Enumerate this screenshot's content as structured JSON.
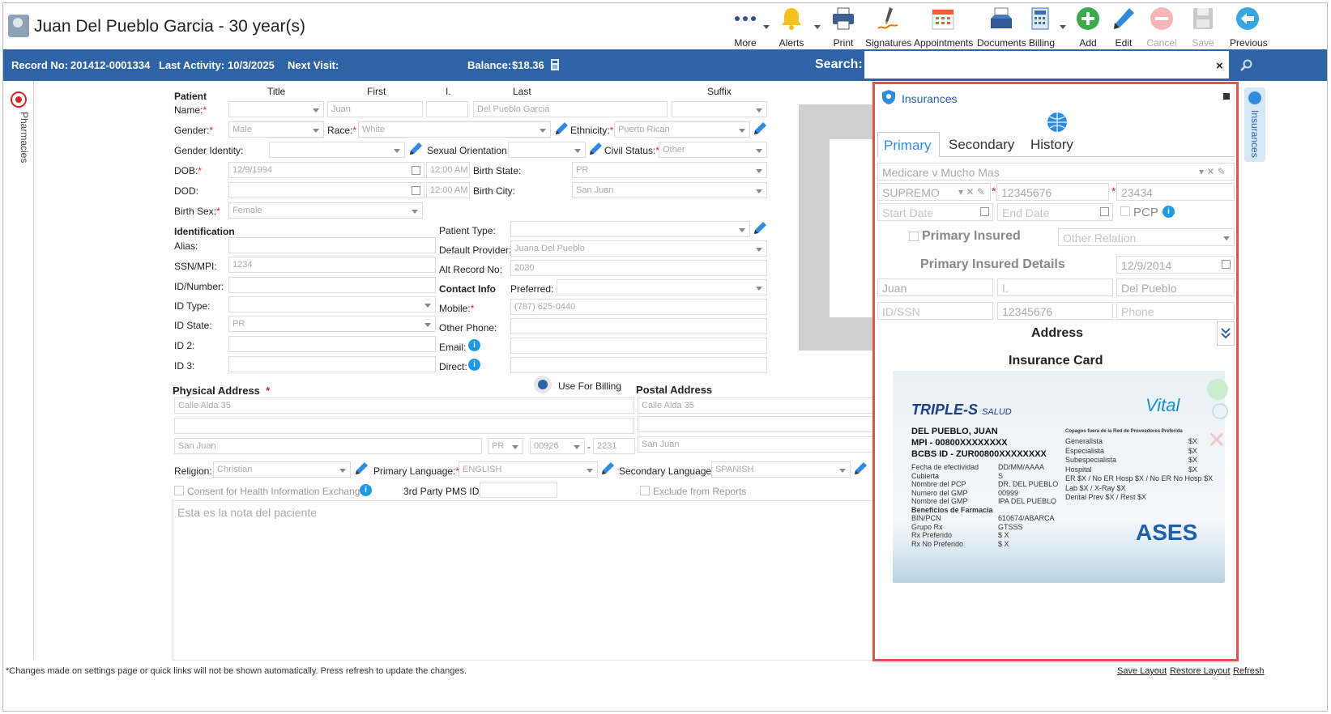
{
  "header": {
    "title": "Juan Del Pueblo Garcia - 30 year(s)",
    "toolbar": {
      "more": "More",
      "alerts": "Alerts",
      "print": "Print",
      "signatures": "Signatures",
      "appointments": "Appointments",
      "documents": "Documents",
      "billing": "Billing",
      "add": "Add",
      "edit": "Edit",
      "cancel": "Cancel",
      "save": "Save",
      "previous": "Previous"
    }
  },
  "infobar": {
    "record_label": "Record No:",
    "record_value": "201412-0001334",
    "activity_label": "Last Activity:",
    "activity_value": "10/3/2025",
    "next_visit_label": "Next Visit:",
    "balance_label": "Balance:",
    "balance_value": "$18.36",
    "search_label": "Search:",
    "search_clear": "×"
  },
  "left_sidebar": {
    "pharmacies": "Pharmacies"
  },
  "right_sidebar": {
    "insurances": "Insurances"
  },
  "patient": {
    "section": "Patient",
    "col_title": "Title",
    "col_first": "First",
    "col_initial": "I.",
    "col_last": "Last",
    "col_suffix": "Suffix",
    "name_label": "Name:",
    "first": "Juan",
    "last": "Del Pueblo Garcia",
    "gender_label": "Gender:",
    "gender": "Male",
    "race_label": "Race:",
    "race": "White",
    "ethnicity_label": "Ethnicity:",
    "ethnicity": "Puerto Rican",
    "gender_identity_label": "Gender Identity:",
    "sexual_orientation_label": "Sexual Orientation:",
    "civil_status_label": "Civil Status:",
    "civil_status": "Other",
    "dob_label": "DOB:",
    "dob": "12/9/1994",
    "dob_time": "12:00 AM",
    "birth_state_label": "Birth State:",
    "birth_state": "PR",
    "dod_label": "DOD:",
    "dod_time": "12:00 AM",
    "birth_city_label": "Birth City:",
    "birth_city": "San Juan",
    "birth_sex_label": "Birth Sex:",
    "birth_sex": "Female"
  },
  "identification": {
    "section": "Identification",
    "alias_label": "Alias:",
    "ssn_label": "SSN/MPI:",
    "ssn": "1234",
    "idnum_label": "ID/Number:",
    "idtype_label": "ID Type:",
    "idstate_label": "ID State:",
    "idstate": "PR",
    "id2_label": "ID 2:",
    "id3_label": "ID 3:",
    "patient_type_label": "Patient Type:",
    "default_provider_label": "Default Provider:",
    "default_provider": "Juana Del Pueblo",
    "alt_record_label": "Alt Record No:",
    "alt_record": "2030"
  },
  "contact": {
    "section": "Contact Info",
    "preferred_label": "Preferred:",
    "mobile_label": "Mobile:",
    "mobile": "(787) 625-0440",
    "other_phone_label": "Other Phone:",
    "email_label": "Email:",
    "direct_label": "Direct:"
  },
  "address": {
    "physical_label": "Physical Address",
    "use_for_billing": "Use For Billing",
    "postal_label": "Postal Address",
    "physical_line1": "Calle Alda 35",
    "physical_city": "San Juan",
    "physical_state": "PR",
    "physical_zip": "00926",
    "physical_zip_sep": "-",
    "physical_zip4": "2231",
    "postal_line1": "Calle Alda 35",
    "postal_city": "San Juan"
  },
  "other": {
    "religion_label": "Religion:",
    "religion": "Christian",
    "primary_language_label": "Primary Language:",
    "primary_language": "ENGLISH",
    "secondary_language_label": "Secondary Language:",
    "secondary_language": "SPANISH",
    "consent_label": "Consent for Health Information Exchange",
    "third_party_label": "3rd Party PMS ID:",
    "exclude_label": "Exclude from Reports",
    "notes": "Esta es la nota del paciente"
  },
  "insurances": {
    "title": "Insurances",
    "tabs": [
      "Primary",
      "Secondary",
      "History"
    ],
    "plan": "Medicare v Mucho Mas",
    "plan_type": "SUPREMO",
    "member_id": "12345676",
    "group": "23434",
    "start_date_ph": "Start Date",
    "end_date_ph": "End Date",
    "pcp": "PCP",
    "primary_insured": "Primary Insured",
    "other_relation": "Other Relation",
    "details": "Primary Insured Details",
    "insured_dob": "12/9/2014",
    "insured_first": "Juan",
    "insured_initial": "I.",
    "insured_last": "Del Pueblo",
    "id_ssn_ph": "ID/SSN",
    "insured_member_id": "12345676",
    "phone_ph": "Phone",
    "address": "Address",
    "card_title": "Insurance Card"
  },
  "card": {
    "brand": "TRIPLE-S",
    "brand2": "SALUD",
    "vital": "Vital",
    "ases": "ASES",
    "name": "DEL PUEBLO, JUAN",
    "mpi": "MPI - 00800XXXXXXXX",
    "bcbs": "BCBS ID - ZUR00800XXXXXXXX",
    "left_labels": [
      "Fecha de efectividad",
      "Cubierta",
      "Nombre del PCP",
      "Numero del GMP",
      "Nombre del GMP",
      "Beneficios de Farmacia",
      "BIN/PCN",
      "Grupo Rx",
      "Rx Preferido",
      "Rx No Preferido"
    ],
    "left_values": [
      "DD/MM/AAAA",
      "S",
      "DR. DEL PUEBLO",
      "00999",
      "IPA DEL PUEBLO",
      "",
      "610674/ABARCA",
      "GTSSS",
      "$ X",
      "$ X"
    ],
    "right_title": "Copagos fuera de la Red de Proveedores Preferida",
    "right_labels": [
      "Generalista",
      "Especialista",
      "Subespecialista",
      "Hospital",
      "ER $X / No ER Hosp $X / No ER No Hosp $X",
      "Lab $X / X-Ray $X",
      "Dental Prev $X / Rest $X"
    ],
    "right_values": [
      "$X",
      "$X",
      "$X",
      "$X",
      "",
      "",
      ""
    ]
  },
  "footer": {
    "note": "*Changes made on settings page or quick links will not be shown automatically. Press refresh to update the changes.",
    "save_layout": "Save Layout",
    "restore_layout": "Restore Layout",
    "refresh": "Refresh"
  },
  "colors": {
    "accent": "#2e63a5",
    "highlight": "#e05353",
    "info": "#1e9be0"
  }
}
